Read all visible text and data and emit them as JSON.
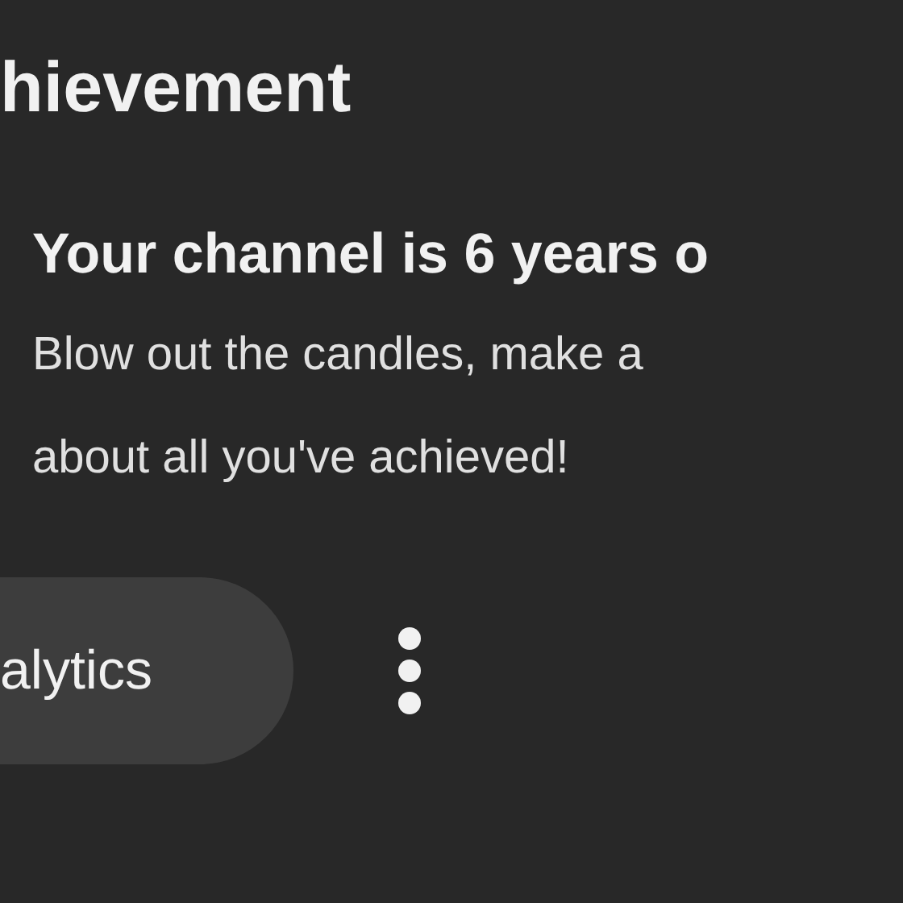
{
  "title": "hievement",
  "card": {
    "heading": "Your channel is 6 years o",
    "body": "Blow out the candles, make a\nabout all you've achieved!"
  },
  "actions": {
    "button": "alytics"
  }
}
